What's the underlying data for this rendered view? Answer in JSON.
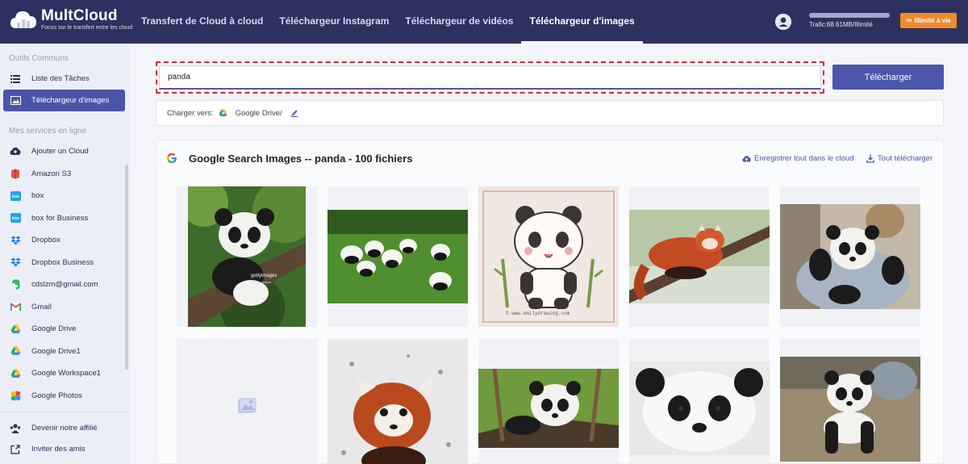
{
  "header": {
    "logo_title": "MultCloud",
    "logo_subtitle": "Focus sur le transfert entre les cloud",
    "nav": [
      {
        "label": "Transfert de Cloud à cloud",
        "active": false
      },
      {
        "label": "Téléchargeur Instagram",
        "active": false
      },
      {
        "label": "Téléchargeur de vidéos",
        "active": false
      },
      {
        "label": "Téléchargeur d'images",
        "active": true
      }
    ],
    "traffic_text": "Trafic:68.61MB/Illimité",
    "traffic_fraction": 1.0,
    "unlimited_label": "Illimité à vie"
  },
  "sidebar": {
    "section_common": "Outils Communs",
    "section_services": "Mes services en ligne",
    "common_items": [
      {
        "label": "Liste des Tâches",
        "icon": "list-icon"
      },
      {
        "label": "Téléchargeur d'images",
        "icon": "image-icon",
        "active": true
      }
    ],
    "service_items": [
      {
        "label": "Ajouter un Cloud",
        "icon": "add-cloud-icon"
      },
      {
        "label": "Amazon S3",
        "icon": "amazon-s3-icon"
      },
      {
        "label": "box",
        "icon": "box-icon"
      },
      {
        "label": "box for Business",
        "icon": "box-business-icon"
      },
      {
        "label": "Dropbox",
        "icon": "dropbox-icon"
      },
      {
        "label": "Dropbox Business",
        "icon": "dropbox-business-icon"
      },
      {
        "label": "cdslzm@gmail.com",
        "icon": "evernote-icon"
      },
      {
        "label": "Gmail",
        "icon": "gmail-icon"
      },
      {
        "label": "Google Drive",
        "icon": "google-drive-icon"
      },
      {
        "label": "Google Drive1",
        "icon": "google-drive-icon"
      },
      {
        "label": "Google Workspace1",
        "icon": "google-workspace-icon"
      },
      {
        "label": "Google Photos",
        "icon": "google-photos-icon"
      }
    ],
    "bottom_items": [
      {
        "label": "Devenir notre affilié",
        "icon": "affiliate-icon"
      },
      {
        "label": "Inviter des amis",
        "icon": "invite-icon"
      }
    ]
  },
  "search": {
    "value": "panda",
    "button_label": "Télécharger"
  },
  "upload": {
    "label": "Charger vers:",
    "destination": "Google Drive/"
  },
  "results": {
    "title": "Google Search Images -- panda - 100 fichiers",
    "save_all_label": "Enregistrer tout dans le cloud",
    "download_all_label": "Tout télécharger",
    "watermarks": {
      "getty": "gettyimages",
      "getty_credit": "Credit: Alatom",
      "emily": "© www.emilydrawing.com"
    },
    "images": [
      {
        "subject": "giant panda cub on tree"
      },
      {
        "subject": "group of pandas on grass"
      },
      {
        "subject": "cartoon panda drawing"
      },
      {
        "subject": "red panda on branch"
      },
      {
        "subject": "panda cub held by keeper"
      },
      {
        "subject": "image placeholder"
      },
      {
        "subject": "red panda in snow"
      },
      {
        "subject": "panda cub on log"
      },
      {
        "subject": "panda face close-up"
      },
      {
        "subject": "panda cub walking"
      }
    ]
  },
  "colors": {
    "header_bg": "#2d3160",
    "accent": "#4c57a9",
    "orange": "#f08a2b",
    "highlight_red": "#d9282f"
  }
}
